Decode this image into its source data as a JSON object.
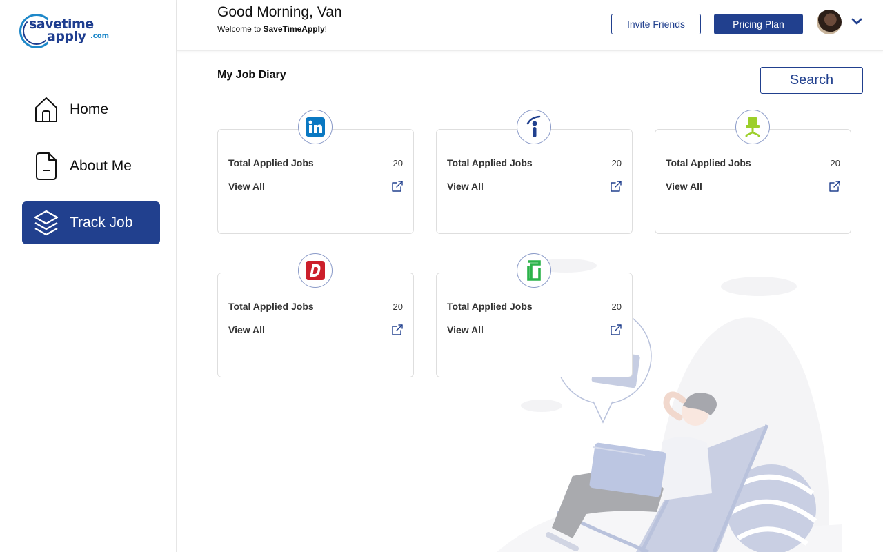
{
  "logo": {
    "line1": "savetime",
    "line2": "apply",
    "suffix": ".com"
  },
  "sidebar": {
    "items": [
      {
        "label": "Home",
        "icon": "home-icon",
        "active": false
      },
      {
        "label": "About Me",
        "icon": "document-icon",
        "active": false
      },
      {
        "label": "Track Job",
        "icon": "layers-icon",
        "active": true
      }
    ]
  },
  "header": {
    "greeting": "Good Morning, Van",
    "welcome_prefix": "Welcome to ",
    "welcome_brand": "SaveTimeApply",
    "welcome_suffix": "!",
    "invite_label": "Invite Friends",
    "pricing_label": "Pricing Plan"
  },
  "main": {
    "title": "My Job Diary",
    "search_label": "Search",
    "cards": [
      {
        "site": "linkedin-logo-icon",
        "label": "Total Applied Jobs",
        "count": "20",
        "view_label": "View All"
      },
      {
        "site": "indeed-logo-icon",
        "label": "Total Applied Jobs",
        "count": "20",
        "view_label": "View All"
      },
      {
        "site": "job-chair-logo-icon",
        "label": "Total Applied Jobs",
        "count": "20",
        "view_label": "View All"
      },
      {
        "site": "dice-logo-icon",
        "label": "Total Applied Jobs",
        "count": "20",
        "view_label": "View All"
      },
      {
        "site": "glassdoor-logo-icon",
        "label": "Total Applied Jobs",
        "count": "20",
        "view_label": "View All"
      }
    ]
  },
  "colors": {
    "brand": "#21408e",
    "accent": "#1e88c9",
    "border": "#dedede"
  }
}
